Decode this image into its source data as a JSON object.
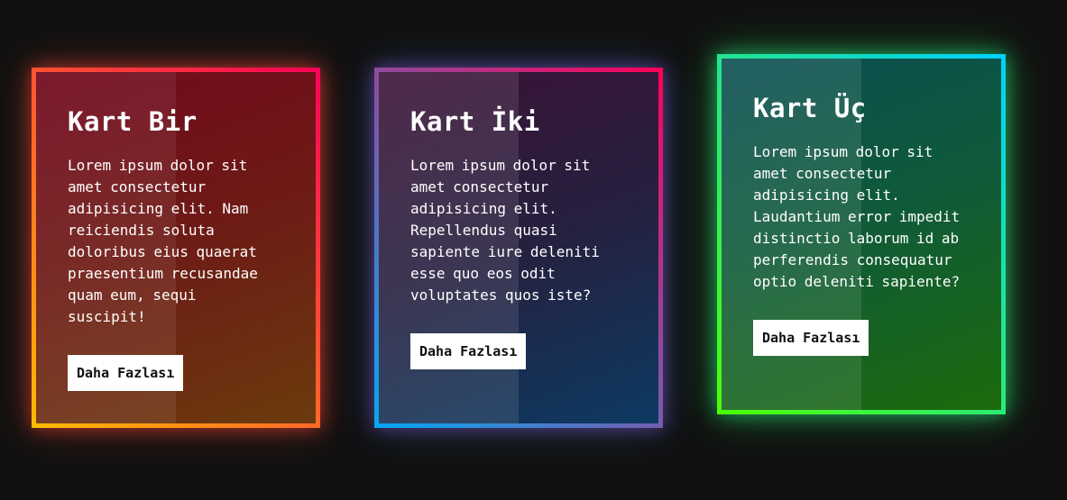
{
  "cards": [
    {
      "title": "Kart Bir",
      "text": "Lorem ipsum dolor sit amet consectetur adipisicing elit. Nam reiciendis soluta doloribus eius quaerat praesentium recusandae quam eum, sequi suscipit!",
      "button_label": "Daha Fazlası",
      "border_gradient": [
        "#ffbc00",
        "#ff0058"
      ]
    },
    {
      "title": "Kart İki",
      "text": "Lorem ipsum dolor sit amet consectetur adipisicing elit. Repellendus quasi sapiente iure deleniti esse quo eos odit voluptates quos iste?",
      "button_label": "Daha Fazlası",
      "border_gradient": [
        "#03a9f4",
        "#ff0058"
      ]
    },
    {
      "title": "Kart Üç",
      "text": "Lorem ipsum dolor sit amet consectetur adipisicing elit. Laudantium error impedit distinctio laborum id ab perferendis consequatur optio deleniti sapiente?",
      "button_label": "Daha Fazlası",
      "border_gradient": [
        "#4dff03",
        "#00d0ff"
      ]
    }
  ],
  "colors": {
    "background": "#111111",
    "button_bg": "#ffffff",
    "button_text": "#111111",
    "text": "#ffffff"
  }
}
